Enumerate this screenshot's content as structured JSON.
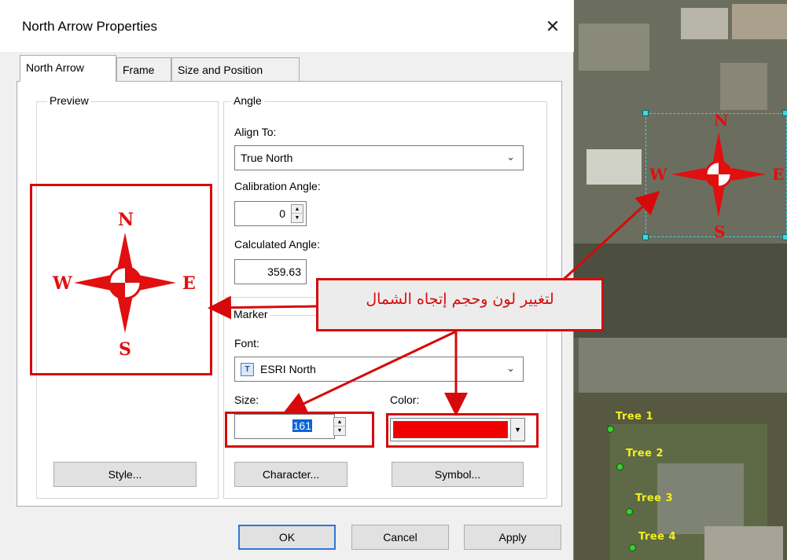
{
  "dialog": {
    "title": "North Arrow Properties",
    "close_glyph": "✕",
    "tabs": [
      {
        "label": "North Arrow",
        "active": true
      },
      {
        "label": "Frame",
        "active": false
      },
      {
        "label": "Size and Position",
        "active": false
      }
    ],
    "preview": {
      "group_label": "Preview",
      "letters": {
        "n": "N",
        "s": "S",
        "e": "E",
        "w": "W"
      },
      "style_button": "Style..."
    },
    "angle": {
      "group_label": "Angle",
      "align_to_label": "Align To:",
      "align_to_value": "True North",
      "calibration_label": "Calibration Angle:",
      "calibration_value": "0",
      "calculated_label": "Calculated Angle:",
      "calculated_value": "359.63"
    },
    "marker": {
      "group_label": "Marker",
      "font_label": "Font:",
      "font_value": "ESRI North",
      "size_label": "Size:",
      "size_value": "161",
      "color_label": "Color:",
      "color_value": "#ee0000",
      "character_button": "Character...",
      "symbol_button": "Symbol..."
    },
    "footer": {
      "ok": "OK",
      "cancel": "Cancel",
      "apply": "Apply"
    }
  },
  "annotation": {
    "callout_text": "لتغيير لون وحجم إتجاه الشمال",
    "color": "#d60a0a"
  },
  "map": {
    "north_arrow_letters": {
      "n": "N",
      "s": "S",
      "e": "E",
      "w": "W"
    },
    "trees": [
      "Tree 1",
      "Tree 2",
      "Tree 3",
      "Tree 4"
    ]
  }
}
